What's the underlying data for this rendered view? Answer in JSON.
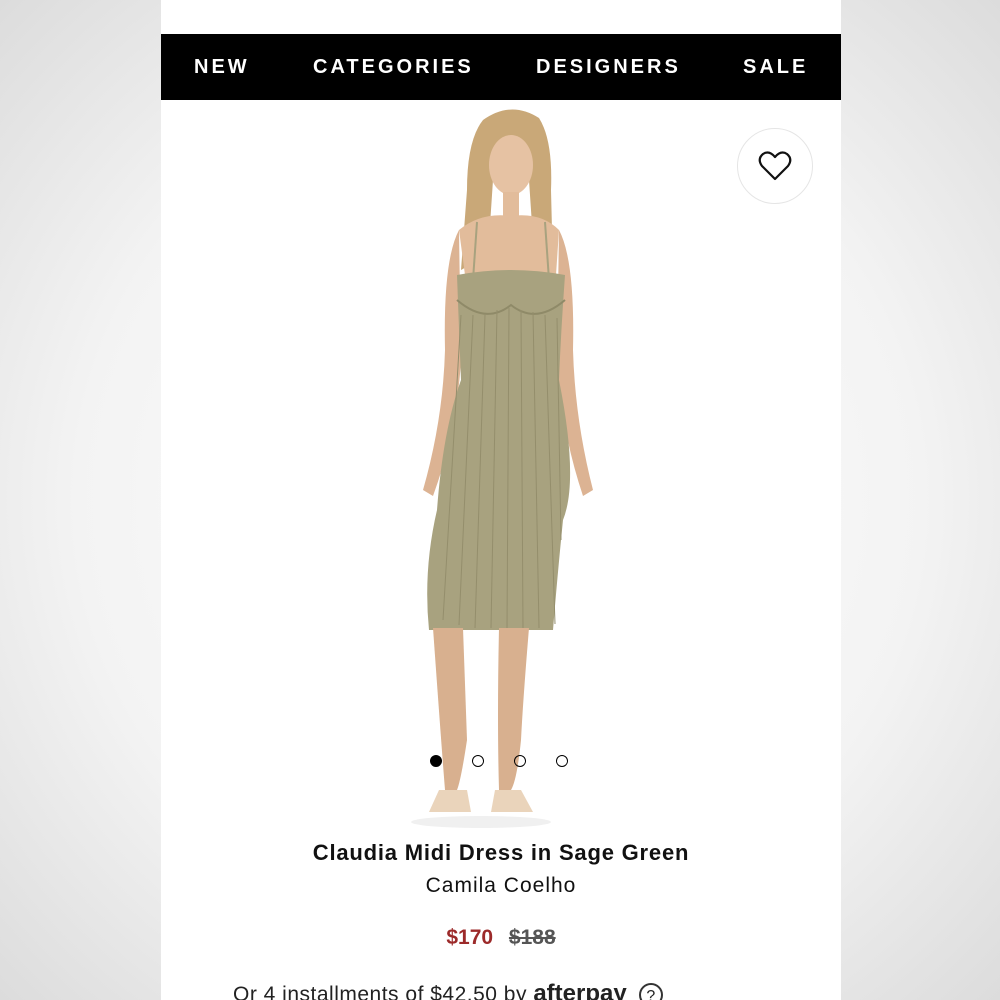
{
  "nav": {
    "items": [
      {
        "label": "NEW"
      },
      {
        "label": "CATEGORIES"
      },
      {
        "label": "DESIGNERS"
      },
      {
        "label": "SALE"
      }
    ]
  },
  "product": {
    "title": "Claudia Midi Dress in Sage Green",
    "designer": "Camila Coelho",
    "price_sale": "$170",
    "price_original": "$188",
    "installments_text": "Or 4 installments of $42.50 by",
    "afterpay_label": "afterpay",
    "help_glyph": "?",
    "image_count": 4,
    "active_image": 1
  },
  "icons": {
    "wishlist": "heart-icon",
    "afterpay_help": "question-circle-icon"
  },
  "colors": {
    "nav_bg": "#000000",
    "sale_price": "#9c2a2a",
    "dress": "#a8a27f"
  }
}
